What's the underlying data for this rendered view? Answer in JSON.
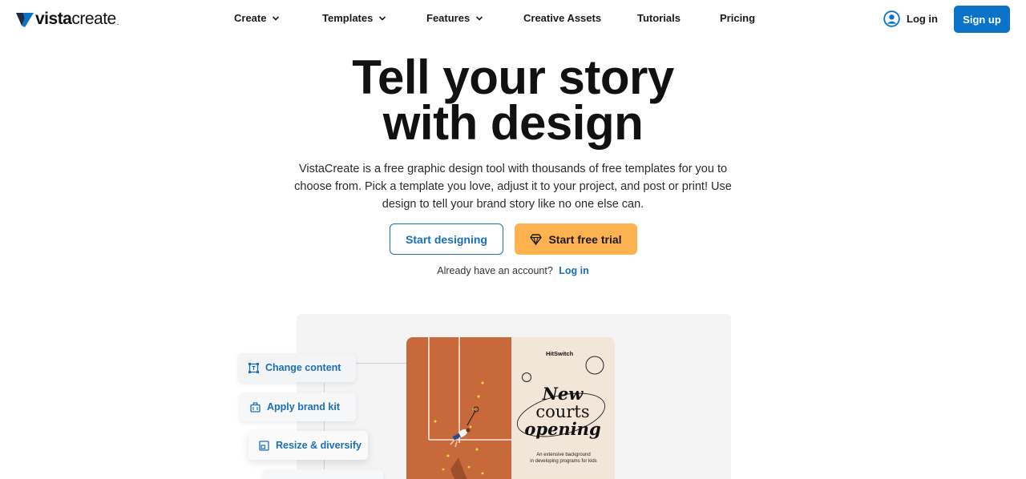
{
  "header": {
    "logo_text_bold": "vista",
    "logo_text_rest": "create",
    "logo_dot": ".",
    "nav": [
      {
        "label": "Create",
        "has_dropdown": true
      },
      {
        "label": "Templates",
        "has_dropdown": true
      },
      {
        "label": "Features",
        "has_dropdown": true
      },
      {
        "label": "Creative Assets",
        "has_dropdown": false
      },
      {
        "label": "Tutorials",
        "has_dropdown": false
      },
      {
        "label": "Pricing",
        "has_dropdown": false
      }
    ],
    "login_label": "Log in",
    "signup_label": "Sign up"
  },
  "hero": {
    "title_line1": "Tell your story",
    "title_line2": "with design",
    "description": "VistaCreate is a free graphic design tool with thousands of free templates for you to choose from. Pick a template you love, adjust it to your project, and post or print! Use design to tell your brand story like no one else can.",
    "start_designing_label": "Start designing",
    "start_trial_label": "Start free trial",
    "already_text": "Already have an account?",
    "login_link": "Log in"
  },
  "demo": {
    "chips": [
      {
        "label": "Change content",
        "icon": "text-frame-icon"
      },
      {
        "label": "Apply brand kit",
        "icon": "briefcase-icon"
      },
      {
        "label": "Resize & diversify",
        "icon": "resize-icon"
      }
    ],
    "poster": {
      "brand": "HitSwitch",
      "headline_line1": "New",
      "headline_line2": "courts",
      "headline_line3": "opening",
      "subtitle_line1": "An extensive background",
      "subtitle_line2": "in developing programs for kids"
    }
  },
  "colors": {
    "primary_blue": "#0a73c9",
    "link_blue": "#1a6fb8",
    "trial_orange": "#fdb24f",
    "court_clay": "#c8693b",
    "poster_cream": "#f2e6d9"
  }
}
